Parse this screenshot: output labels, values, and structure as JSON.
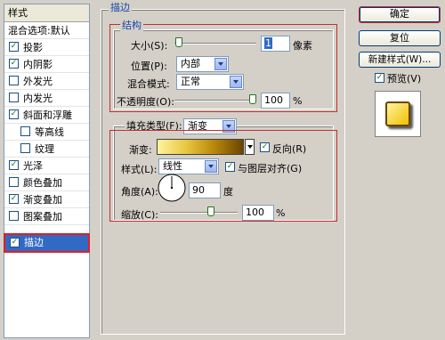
{
  "styles_panel": {
    "header": "样式",
    "items": [
      {
        "label": "混合选项:默认",
        "checkbox": false,
        "checked": false,
        "indent": false,
        "selected": false
      },
      {
        "label": "投影",
        "checkbox": true,
        "checked": true,
        "indent": false,
        "selected": false
      },
      {
        "label": "内阴影",
        "checkbox": true,
        "checked": true,
        "indent": false,
        "selected": false
      },
      {
        "label": "外发光",
        "checkbox": true,
        "checked": false,
        "indent": false,
        "selected": false
      },
      {
        "label": "内发光",
        "checkbox": true,
        "checked": false,
        "indent": false,
        "selected": false
      },
      {
        "label": "斜面和浮雕",
        "checkbox": true,
        "checked": true,
        "indent": false,
        "selected": false
      },
      {
        "label": "等高线",
        "checkbox": true,
        "checked": false,
        "indent": true,
        "selected": false
      },
      {
        "label": "纹理",
        "checkbox": true,
        "checked": false,
        "indent": true,
        "selected": false
      },
      {
        "label": "光泽",
        "checkbox": true,
        "checked": true,
        "indent": false,
        "selected": false
      },
      {
        "label": "颜色叠加",
        "checkbox": true,
        "checked": false,
        "indent": false,
        "selected": false
      },
      {
        "label": "渐变叠加",
        "checkbox": true,
        "checked": true,
        "indent": false,
        "selected": false
      },
      {
        "label": "图案叠加",
        "checkbox": true,
        "checked": false,
        "indent": false,
        "selected": false
      },
      {
        "label": "描边",
        "checkbox": true,
        "checked": true,
        "indent": false,
        "selected": true
      }
    ]
  },
  "stroke": {
    "title": "描边",
    "structure": {
      "title": "结构",
      "size_label": "大小(S):",
      "size_value": "1",
      "size_unit": "像素",
      "size_level": 0.01,
      "position_label": "位置(P):",
      "position_value": "内部",
      "blend_label": "混合模式:",
      "blend_value": "正常",
      "opacity_label": "不透明度(O):",
      "opacity_value": "100",
      "opacity_unit": "%",
      "opacity_level": 1.0
    },
    "fill": {
      "type_label": "填充类型(F):",
      "type_value": "渐变",
      "gradient_label": "渐变:",
      "gradient_colors": [
        "#fff3a0",
        "#e8c840",
        "#b8860b",
        "#6b4500"
      ],
      "reverse_label": "反向(R)",
      "reverse_checked": true,
      "style_label": "样式(L):",
      "style_value": "线性",
      "align_label": "与图层对齐(G)",
      "align_checked": true,
      "angle_label": "角度(A):",
      "angle_value": "90",
      "angle_unit": "度",
      "scale_label": "缩放(C):",
      "scale_value": "100",
      "scale_unit": "%",
      "scale_level": 0.67
    }
  },
  "buttons": {
    "ok": "确定",
    "reset": "复位",
    "new_style": "新建样式(W)...",
    "preview_label": "预览(V)",
    "preview_checked": true
  },
  "colors": {
    "selection": "#316ac5",
    "highlight_box": "#c03030",
    "section_title": "#1848a8",
    "preview_fill": "#f0c000"
  }
}
